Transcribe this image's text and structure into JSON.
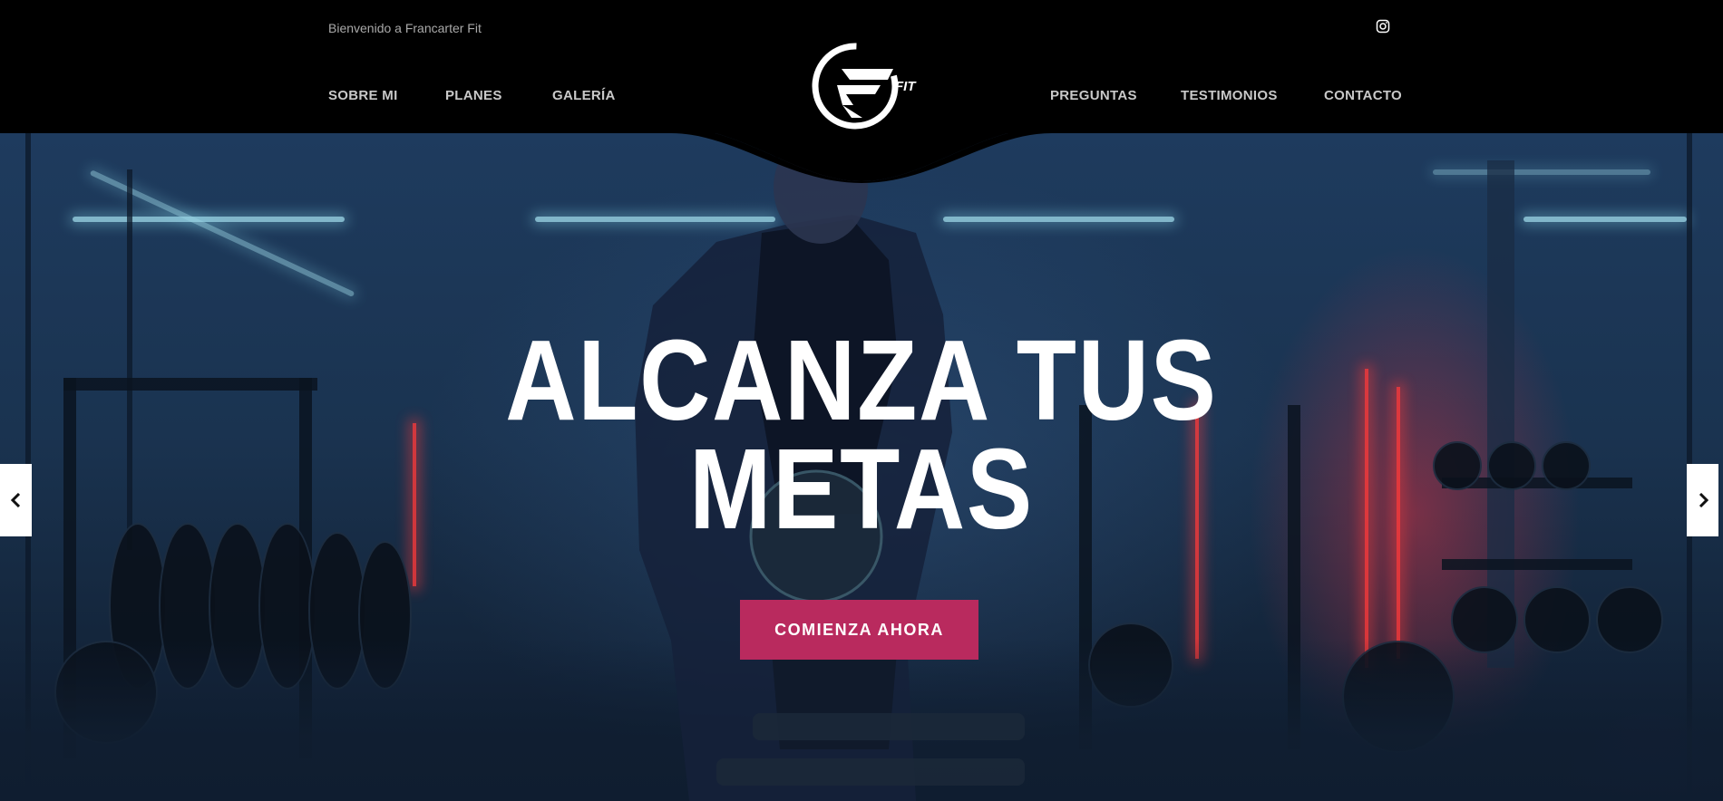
{
  "topbar": {
    "welcome_text": "Bienvenido a Francarter Fit",
    "social_icon": "instagram-icon"
  },
  "nav": {
    "left": [
      {
        "label": "SOBRE MI"
      },
      {
        "label": "PLANES"
      },
      {
        "label": "GALERÍA"
      }
    ],
    "right": [
      {
        "label": "PREGUNTAS"
      },
      {
        "label": "TESTIMONIOS"
      },
      {
        "label": "CONTACTO"
      }
    ]
  },
  "logo": {
    "text": "FIT",
    "icon": "francarter-fit-logo"
  },
  "hero": {
    "title_line1": "ALCANZA TUS",
    "title_line2": "METAS",
    "cta_label": "COMIENZA AHORA",
    "prev_icon": "chevron-left-icon",
    "next_icon": "chevron-right-icon"
  },
  "colors": {
    "accent": "#b92a5e",
    "header_bg": "#000000",
    "nav_text": "#c9c9c9"
  }
}
